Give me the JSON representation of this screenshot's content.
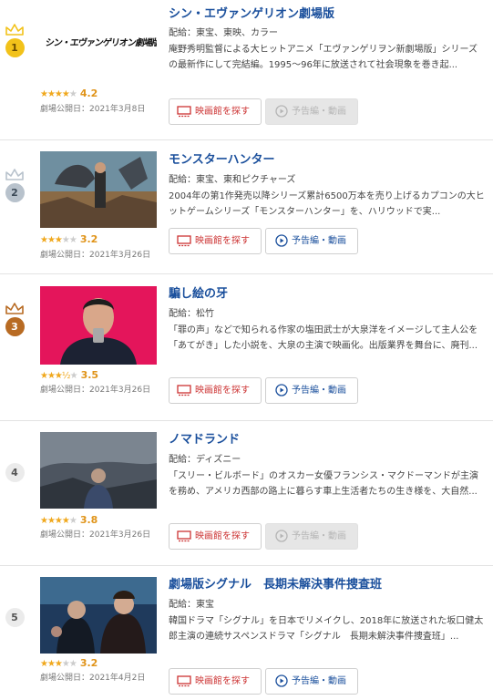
{
  "colors": {
    "link": "#1a4f9c",
    "star": "#f0a81d",
    "theater_button": "#cc3333",
    "gold": "#f2c21a",
    "silver": "#b8c2cc",
    "bronze": "#b86b23"
  },
  "buttons": {
    "theater_label": "映画館を探す",
    "trailer_label": "予告編・動画"
  },
  "movies": [
    {
      "rank": "1",
      "title": "シン・エヴァンゲリオン劇場版",
      "thumb_text": "シン・エヴァンゲリオン劇場版:||",
      "distributor": "配給：東宝、東映、カラー",
      "description": "庵野秀明監督による大ヒットアニメ「エヴァンゲリヲン新劇場版」シリーズの最新作にして完結編。1995～96年に放送されて社会現象を巻き起...",
      "stars": "★★★★",
      "stars_off": "★",
      "rating": "4.2",
      "release": "劇場公開日：2021年3月8日",
      "trailer_available": false
    },
    {
      "rank": "2",
      "title": "モンスターハンター",
      "distributor": "配給：東宝、東和ピクチャーズ",
      "description": "2004年の第1作発売以降シリーズ累計6500万本を売り上げるカプコンの大ヒットゲームシリーズ「モンスターハンター」を、ハリウッドで実...",
      "stars": "★★★",
      "stars_off": "★★",
      "rating": "3.2",
      "release": "劇場公開日：2021年3月26日",
      "trailer_available": true
    },
    {
      "rank": "3",
      "title": "騙し絵の牙",
      "distributor": "配給：松竹",
      "description": "「罪の声」などで知られる作家の塩田武士が大泉洋をイメージして主人公を「あてがき」した小説を、大泉の主演で映画化。出版業界を舞台に、廃刊...",
      "stars": "★★★½",
      "stars_off": "★",
      "rating": "3.5",
      "release": "劇場公開日：2021年3月26日",
      "trailer_available": true
    },
    {
      "rank": "4",
      "title": "ノマドランド",
      "distributor": "配給：ディズニー",
      "description": "「スリー・ビルボード」のオスカー女優フランシス・マクドーマンドが主演を務め、アメリカ西部の路上に暮らす車上生活者たちの生き様を、大自然...",
      "stars": "★★★★",
      "stars_off": "★",
      "rating": "3.8",
      "release": "劇場公開日：2021年3月26日",
      "trailer_available": false
    },
    {
      "rank": "5",
      "title": "劇場版シグナル　長期未解決事件捜査班",
      "distributor": "配給：東宝",
      "description": "韓国ドラマ「シグナル」を日本でリメイクし、2018年に放送された坂口健太郎主演の連続サスペンスドラマ「シグナル　長期未解決事件捜査班」...",
      "stars": "★★★",
      "stars_off": "★★",
      "rating": "3.2",
      "release": "劇場公開日：2021年4月2日",
      "trailer_available": true
    }
  ]
}
